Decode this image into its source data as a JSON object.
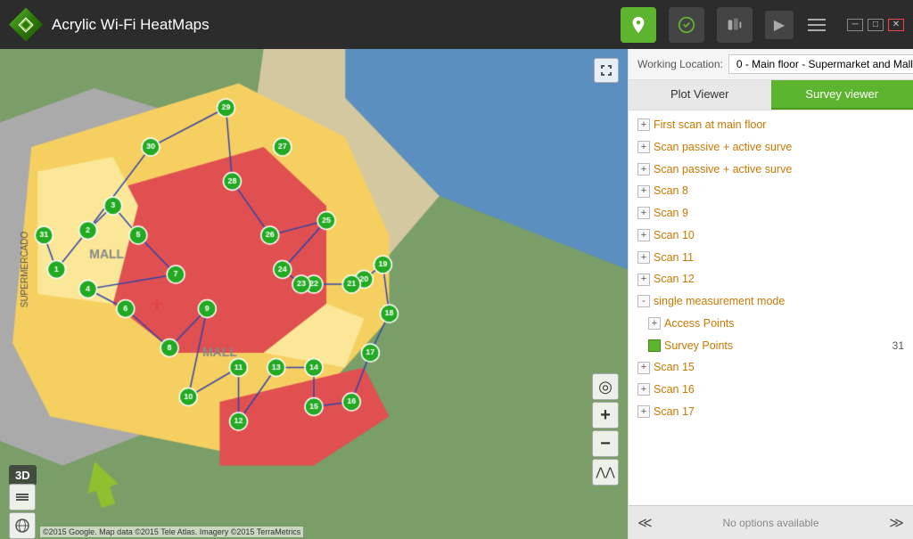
{
  "app": {
    "title": "Acrylic Wi-Fi HeatMaps",
    "working_location_label": "Working Location:",
    "working_location_value": "0 - Main floor - Supermarket and Mall"
  },
  "tabs": [
    {
      "id": "plot",
      "label": "Plot Viewer",
      "active": false
    },
    {
      "id": "survey",
      "label": "Survey viewer",
      "active": true
    }
  ],
  "tree": [
    {
      "id": "first-scan",
      "level": 0,
      "expand": "+",
      "label": "First scan at main floor",
      "badge": ""
    },
    {
      "id": "scan-passive-1",
      "level": 0,
      "expand": "+",
      "label": "Scan passive + active surve",
      "badge": ""
    },
    {
      "id": "scan-passive-2",
      "level": 0,
      "expand": "+",
      "label": "Scan passive + active surve",
      "badge": ""
    },
    {
      "id": "scan-8",
      "level": 0,
      "expand": "+",
      "label": "Scan 8",
      "badge": ""
    },
    {
      "id": "scan-9",
      "level": 0,
      "expand": "+",
      "label": "Scan 9",
      "badge": ""
    },
    {
      "id": "scan-10",
      "level": 0,
      "expand": "+",
      "label": "Scan 10",
      "badge": ""
    },
    {
      "id": "scan-11",
      "level": 0,
      "expand": "+",
      "label": "Scan 11",
      "badge": ""
    },
    {
      "id": "scan-12",
      "level": 0,
      "expand": "+",
      "label": "Scan 12",
      "badge": ""
    },
    {
      "id": "single-measurement",
      "level": 0,
      "expand": "-",
      "label": "single measurement mode",
      "badge": ""
    },
    {
      "id": "access-points",
      "level": 1,
      "expand": "+",
      "label": "Access Points",
      "badge": ""
    },
    {
      "id": "survey-points",
      "level": 1,
      "expand": null,
      "colorBox": true,
      "label": "Survey Points",
      "badge": "31"
    },
    {
      "id": "scan-15",
      "level": 0,
      "expand": "+",
      "label": "Scan 15",
      "badge": ""
    },
    {
      "id": "scan-16",
      "level": 0,
      "expand": "+",
      "label": "Scan 16",
      "badge": ""
    },
    {
      "id": "scan-17",
      "level": 0,
      "expand": "+",
      "label": "Scan 17",
      "badge": ""
    }
  ],
  "bottom_bar": {
    "no_options_text": "No options available"
  },
  "map": {
    "attribution": "©2015 Google. Map data ©2015 Tele Atlas. Imagery ©2015 TerraMetrics",
    "points": [
      1,
      2,
      3,
      4,
      5,
      6,
      7,
      8,
      9,
      10,
      11,
      12,
      13,
      14,
      15,
      16,
      17,
      18,
      19,
      20,
      21,
      22,
      23,
      24,
      25,
      26,
      27,
      28,
      29,
      30,
      31
    ],
    "btn_3d": "3D"
  },
  "icons": {
    "minimize": "─",
    "maximize": "□",
    "close": "✕",
    "play": "▶",
    "compass": "◎",
    "plus": "+",
    "minus": "−",
    "double_chevron_up": "⋀⋀",
    "expand_map": "⤢",
    "layers": "⊞",
    "globe": "🌐",
    "menu": "≡"
  }
}
